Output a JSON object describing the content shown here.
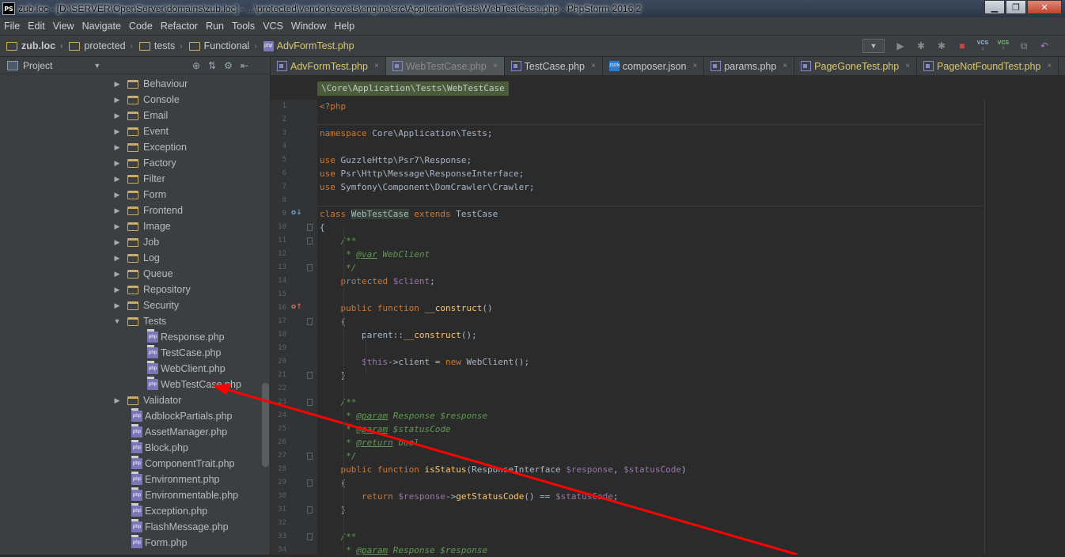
{
  "window": {
    "title": "zub.loc - [D:\\SERVER\\OpenServer\\domains\\zub.loc] - ...\\protected\\vendor\\sovets\\engine\\src\\Application\\Tests\\WebTestCase.php - PhpStorm 2016.2",
    "app_icon": "PS",
    "minimize": "▁",
    "maximize": "❐",
    "close": "✕"
  },
  "menu": [
    "File",
    "Edit",
    "View",
    "Navigate",
    "Code",
    "Refactor",
    "Run",
    "Tools",
    "VCS",
    "Window",
    "Help"
  ],
  "breadcrumbs": [
    "zub.loc",
    "protected",
    "tests",
    "Functional",
    "AdvFormTest.php"
  ],
  "sidebar": {
    "title": "Project",
    "tree": [
      {
        "label": "Behaviour",
        "type": "folder"
      },
      {
        "label": "Console",
        "type": "folder"
      },
      {
        "label": "Email",
        "type": "folder"
      },
      {
        "label": "Event",
        "type": "folder"
      },
      {
        "label": "Exception",
        "type": "folder"
      },
      {
        "label": "Factory",
        "type": "folder"
      },
      {
        "label": "Filter",
        "type": "folder"
      },
      {
        "label": "Form",
        "type": "folder"
      },
      {
        "label": "Frontend",
        "type": "folder"
      },
      {
        "label": "Image",
        "type": "folder"
      },
      {
        "label": "Job",
        "type": "folder"
      },
      {
        "label": "Log",
        "type": "folder"
      },
      {
        "label": "Queue",
        "type": "folder"
      },
      {
        "label": "Repository",
        "type": "folder"
      },
      {
        "label": "Security",
        "type": "folder"
      },
      {
        "label": "Tests",
        "type": "folder-open"
      },
      {
        "label": "Response.php",
        "type": "file",
        "depth": 2
      },
      {
        "label": "TestCase.php",
        "type": "file",
        "depth": 2
      },
      {
        "label": "WebClient.php",
        "type": "file",
        "depth": 2
      },
      {
        "label": "WebTestCase.php",
        "type": "file",
        "depth": 2
      },
      {
        "label": "Validator",
        "type": "folder"
      },
      {
        "label": "AdblockPartials.php",
        "type": "file",
        "depth": 1
      },
      {
        "label": "AssetManager.php",
        "type": "file",
        "depth": 1
      },
      {
        "label": "Block.php",
        "type": "file",
        "depth": 1
      },
      {
        "label": "ComponentTrait.php",
        "type": "file",
        "depth": 1
      },
      {
        "label": "Environment.php",
        "type": "file",
        "depth": 1
      },
      {
        "label": "Environmentable.php",
        "type": "file",
        "depth": 1
      },
      {
        "label": "Exception.php",
        "type": "file",
        "depth": 1
      },
      {
        "label": "FlashMessage.php",
        "type": "file",
        "depth": 1
      },
      {
        "label": "Form.php",
        "type": "file",
        "depth": 1
      }
    ]
  },
  "tabs": [
    {
      "label": "AdvFormTest.php",
      "style": "warn"
    },
    {
      "label": "WebTestCase.php",
      "style": "active"
    },
    {
      "label": "TestCase.php",
      "style": "normal"
    },
    {
      "label": "composer.json",
      "style": "json"
    },
    {
      "label": "params.php",
      "style": "normal"
    },
    {
      "label": "PageGoneTest.php",
      "style": "warn"
    },
    {
      "label": "PageNotFoundTest.php",
      "style": "warn"
    }
  ],
  "namespace_breadcrumb": "\\Core\\Application\\Tests\\WebTestCase",
  "editor": {
    "line_numbers": [
      "1",
      "2",
      "3",
      "4",
      "5",
      "6",
      "7",
      "8",
      "9",
      "10",
      "11",
      "12",
      "13",
      "14",
      "15",
      "16",
      "17",
      "18",
      "19",
      "20",
      "21",
      "22",
      "23",
      "24",
      "25",
      "26",
      "27",
      "28",
      "29",
      "30",
      "31",
      "32",
      "33",
      "34"
    ],
    "lines": [
      "<?php",
      "",
      "namespace Core\\Application\\Tests;",
      "",
      "use GuzzleHttp\\Psr7\\Response;",
      "use Psr\\Http\\Message\\ResponseInterface;",
      "use Symfony\\Component\\DomCrawler\\Crawler;",
      "",
      "class WebTestCase extends TestCase",
      "{",
      "    /**",
      "     * @var WebClient",
      "     */",
      "    protected $client;",
      "",
      "    public function __construct()",
      "    {",
      "        parent::__construct();",
      "",
      "        $this->client = new WebClient();",
      "    }",
      "",
      "    /**",
      "     * @param Response $response",
      "     * @param $statusCode",
      "     * @return bool",
      "     */",
      "    public function isStatus(ResponseInterface $response, $statusCode)",
      "    {",
      "        return $response->getStatusCode() == $statusCode;",
      "    }",
      "",
      "    /**",
      "     * @param Response $response"
    ]
  },
  "colors": {
    "keyword": "#cc7832",
    "function": "#ffc66d",
    "variable": "#9876aa",
    "comment": "#629755",
    "arrow": "#ff0000"
  }
}
